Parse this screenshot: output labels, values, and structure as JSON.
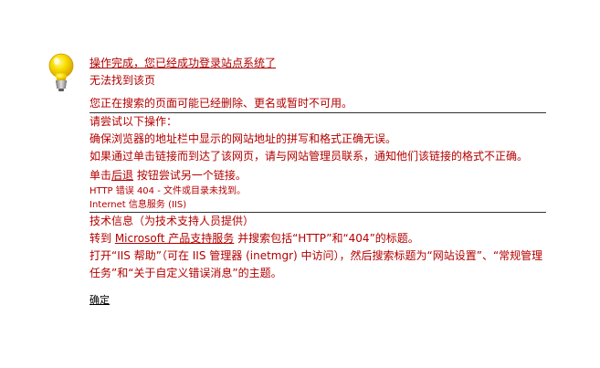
{
  "header": {
    "title_link": "操作完成，您已经成功登录站点系统了",
    "cannot_find": "无法找到该页"
  },
  "main": {
    "removed_msg": "您正在搜索的页面可能已经删除、更名或暂时不可用。",
    "try_heading": "请尝试以下操作：",
    "check_address": "确保浏览器的地址栏中显示的网站地址的拼写和格式正确无误。",
    "contact_admin": "如果通过单击链接而到达了该网页，请与网站管理员联系，通知他们该链接的格式不正确。",
    "back_link": "后退",
    "back_prefix": "单击",
    "back_suffix": " 按钮尝试另一个链接。",
    "http_error": "HTTP 错误 404 - 文件或目录未找到。",
    "iis_service": "Internet 信息服务 (IIS)"
  },
  "tech": {
    "heading": "技术信息（为技术支持人员提供）",
    "goto_prefix": "转到 ",
    "support_link": "Microsoft 产品支持服务",
    "goto_suffix": " 并搜索包括“HTTP”和“404”的标题。",
    "open_iis": "打开“IIS 帮助”（可在 IIS 管理器 (inetmgr) 中访问），然后搜索标题为“网站设置”、“常规管理任务”和“关于自定义错误消息”的主题。"
  },
  "footer": {
    "ok_label": "确定"
  },
  "colors": {
    "text": "#b30000",
    "rule": "#333333",
    "bulb": "#f5c800"
  },
  "icons": {
    "bulb": "lightbulb-icon"
  }
}
